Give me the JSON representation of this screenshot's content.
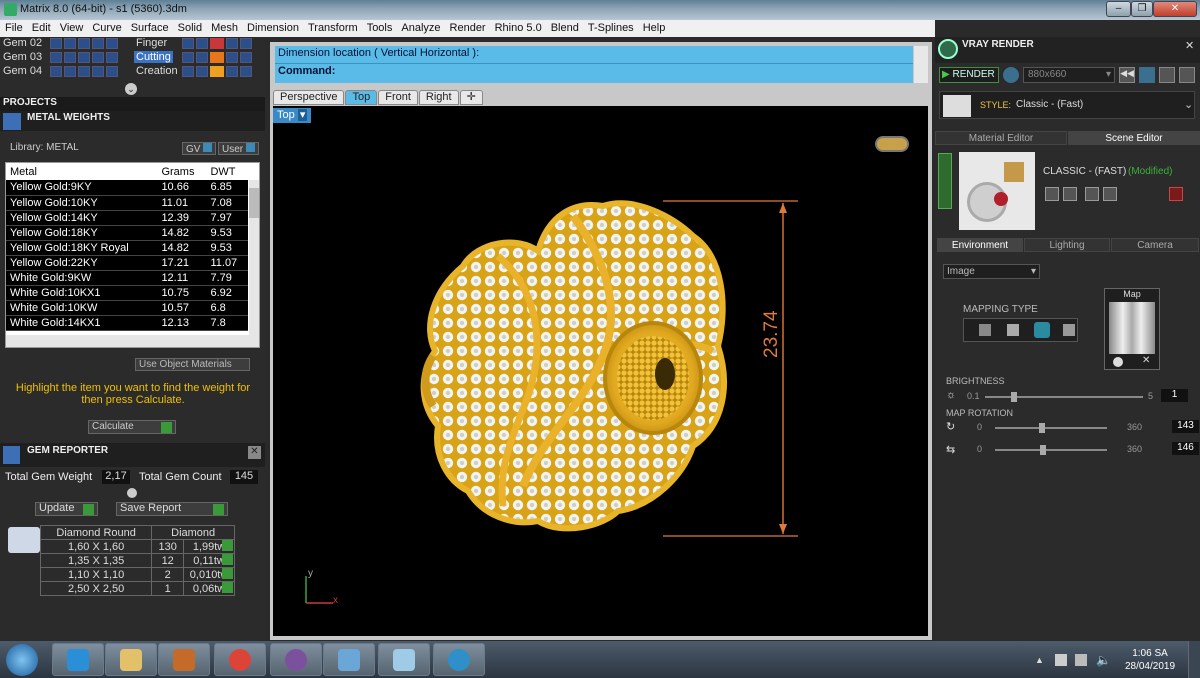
{
  "window": {
    "title": "Matrix 8.0 (64-bit) - s1 (5360).3dm"
  },
  "menu": [
    "File",
    "Edit",
    "View",
    "Curve",
    "Surface",
    "Solid",
    "Mesh",
    "Dimension",
    "Transform",
    "Tools",
    "Analyze",
    "Render",
    "Rhino 5.0",
    "Blend",
    "T-Splines",
    "Help"
  ],
  "layers": [
    {
      "name": "Gem 02",
      "tag": "Finger",
      "color": "#c8373a"
    },
    {
      "name": "Gem 03",
      "tag": "Cutting",
      "color": "#e8761a"
    },
    {
      "name": "Gem 04",
      "tag": "Creation",
      "color": "#f0a020"
    }
  ],
  "projects": {
    "title": "PROJECTS"
  },
  "metal_weights": {
    "title": "METAL WEIGHTS",
    "library_label": "Library: METAL",
    "gv_label": "GV",
    "user_label": "User",
    "columns": [
      "Metal",
      "Grams",
      "DWT"
    ],
    "rows": [
      [
        "Yellow Gold:9KY",
        "10.66",
        "6.85"
      ],
      [
        "Yellow Gold:10KY",
        "11.01",
        "7.08"
      ],
      [
        "Yellow Gold:14KY",
        "12.39",
        "7.97"
      ],
      [
        "Yellow Gold:18KY",
        "14.82",
        "9.53"
      ],
      [
        "Yellow Gold:18KY Royal",
        "14.82",
        "9.53"
      ],
      [
        "Yellow Gold:22KY",
        "17.21",
        "11.07"
      ],
      [
        "White Gold:9KW",
        "12.11",
        "7.79"
      ],
      [
        "White Gold:10KX1",
        "10.75",
        "6.92"
      ],
      [
        "White Gold:10KW",
        "10.57",
        "6.8"
      ],
      [
        "White Gold:14KX1",
        "12.13",
        "7.8"
      ]
    ],
    "use_object_materials": "Use Object Materials",
    "hint": "Highlight the item you want to find the weight for then press Calculate.",
    "calculate": "Calculate"
  },
  "gem_reporter": {
    "title": "GEM REPORTER",
    "total_weight_label": "Total Gem Weight",
    "total_weight": "2,17",
    "total_count_label": "Total Gem Count",
    "total_count": "145",
    "update": "Update",
    "save_report": "Save Report",
    "headers": [
      "Diamond Round",
      "Diamond"
    ],
    "rows": [
      [
        "1,60 X 1,60",
        "130",
        "1,99tw"
      ],
      [
        "1,35 X 1,35",
        "12",
        "0,11tw"
      ],
      [
        "1,10 X 1,10",
        "2",
        "0,010tw"
      ],
      [
        "2,50 X 2,50",
        "1",
        "0,06tw"
      ]
    ]
  },
  "command": {
    "prompt1": "Dimension location ( Vertical  Horizontal ):",
    "prompt2": "Command:"
  },
  "viewport": {
    "tabs": [
      "Perspective",
      "Top",
      "Front",
      "Right"
    ],
    "active_tab": "Top",
    "view_label": "Top",
    "dimension": "23.74",
    "axis_x": "x",
    "axis_y": "y"
  },
  "vray": {
    "title": "VRAY RENDER",
    "render": "RENDER",
    "resolution": "880x660",
    "style_label": "STYLE:",
    "style_value": "Classic - (Fast)",
    "tab_material": "Material Editor",
    "tab_scene": "Scene Editor",
    "preset": "CLASSIC - (FAST)",
    "modified": "(Modified)",
    "tabs2": [
      "Environment",
      "Lighting",
      "Camera"
    ],
    "env_type": "Image",
    "mapping_type": "MAPPING TYPE",
    "map_label": "Map",
    "brightness_label": "BRIGHTNESS",
    "brightness_min": "0.1",
    "brightness_max": "5",
    "brightness_val": "1",
    "map_rotation_label": "MAP ROTATION",
    "rot1_min": "0",
    "rot1_max": "360",
    "rot1_val": "143",
    "rot2_min": "0",
    "rot2_max": "360",
    "rot2_val": "146"
  },
  "tray": {
    "time": "1:06 SA",
    "date": "28/04/2019"
  }
}
